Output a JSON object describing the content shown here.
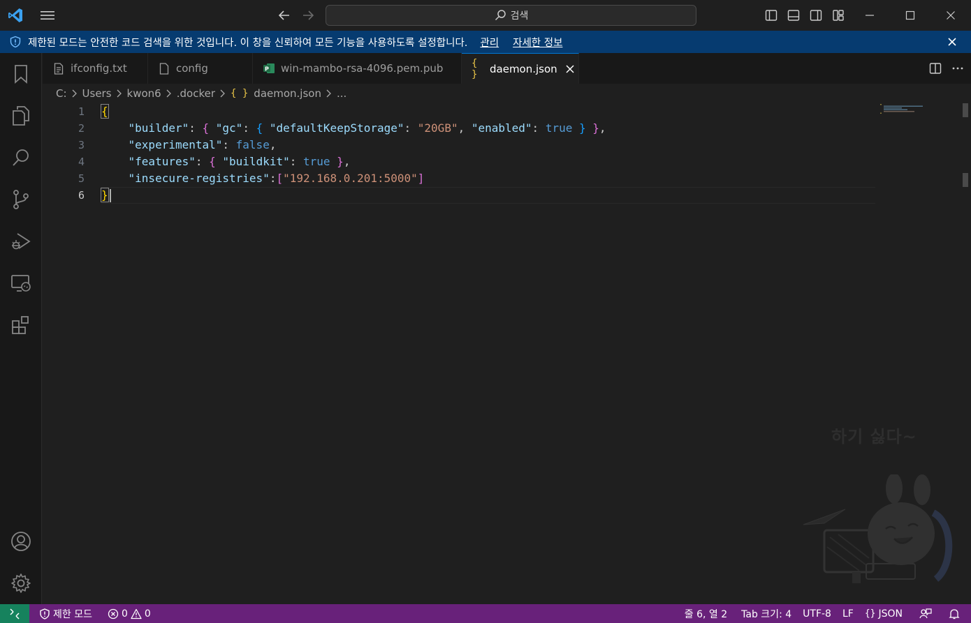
{
  "titlebar": {
    "search_label": "검색"
  },
  "banner": {
    "message": "제한된 모드는 안전한 코드 검색을 위한 것입니다. 이 창을 신뢰하여 모든 기능을 사용하도록 설정합니다.",
    "manage_link": "관리",
    "more_info_link": "자세한 정보"
  },
  "tabs": [
    {
      "label": "ifconfig.txt",
      "icon": "file-text-icon",
      "active": false
    },
    {
      "label": "config",
      "icon": "file-icon",
      "active": false
    },
    {
      "label": "win-mambo-rsa-4096.pem.pub",
      "icon": "publisher-file-icon",
      "active": false
    },
    {
      "label": "daemon.json",
      "icon": "json-braces-icon",
      "active": true
    }
  ],
  "breadcrumb": {
    "items": [
      "C:",
      "Users",
      "kwon6",
      ".docker",
      "daemon.json",
      "..."
    ],
    "json_icon": "{ }"
  },
  "editor": {
    "line_numbers": [
      "1",
      "2",
      "3",
      "4",
      "5",
      "6"
    ],
    "current_line": 6
  },
  "watermark": {
    "text": "하기 싫다~"
  },
  "statusbar": {
    "restricted_mode": "제한 모드",
    "errors": "0",
    "warnings": "0",
    "position": "줄 6, 열 2",
    "tab_size": "Tab 크기: 4",
    "encoding": "UTF-8",
    "eol": "LF",
    "language": "JSON"
  },
  "colors": {
    "accent": "#0078d4",
    "banner_bg": "#063b70",
    "statusbar_bg": "#68217a",
    "remote_bg": "#16825d"
  }
}
